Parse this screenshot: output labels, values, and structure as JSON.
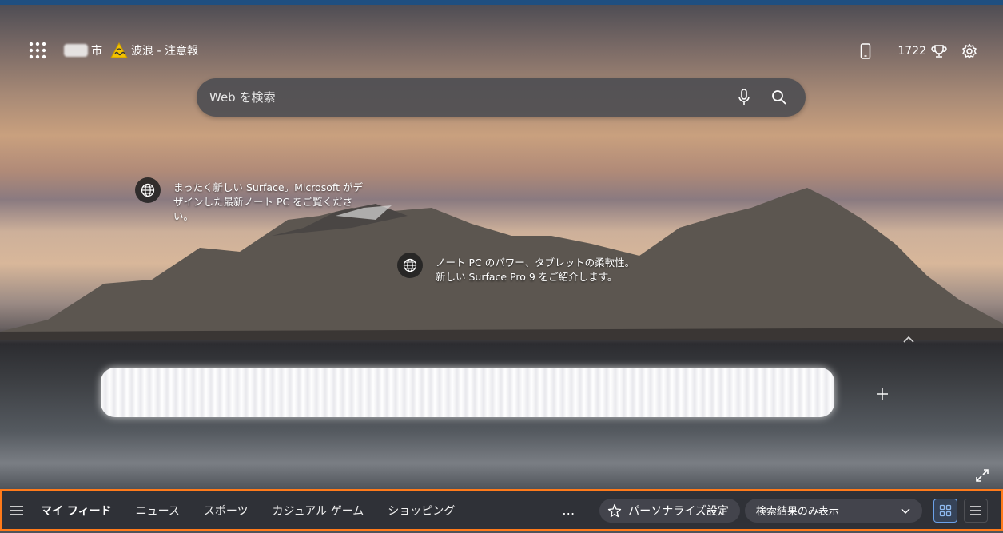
{
  "top_bar": {
    "location_suffix": "市",
    "weather_alert": "波浪 - 注意報",
    "points": "1722"
  },
  "search": {
    "placeholder": "Web を検索"
  },
  "hotspots": [
    {
      "text": "まったく新しい Surface。Microsoft がデザインした最新ノート PC をご覧ください。"
    },
    {
      "text": "ノート PC のパワー、タブレットの柔軟性。新しい Surface Pro 9 をご紹介します。"
    }
  ],
  "bottom_nav": {
    "tabs": [
      "マイ フィード",
      "ニュース",
      "スポーツ",
      "カジュアル ゲーム",
      "ショッピング"
    ],
    "more": "…",
    "personalize": "パーソナライズ設定",
    "view_select": "検索結果のみ表示"
  },
  "colors": {
    "nav_border": "#ff7a1a",
    "grid_view_accent": "#6aa0e8"
  }
}
